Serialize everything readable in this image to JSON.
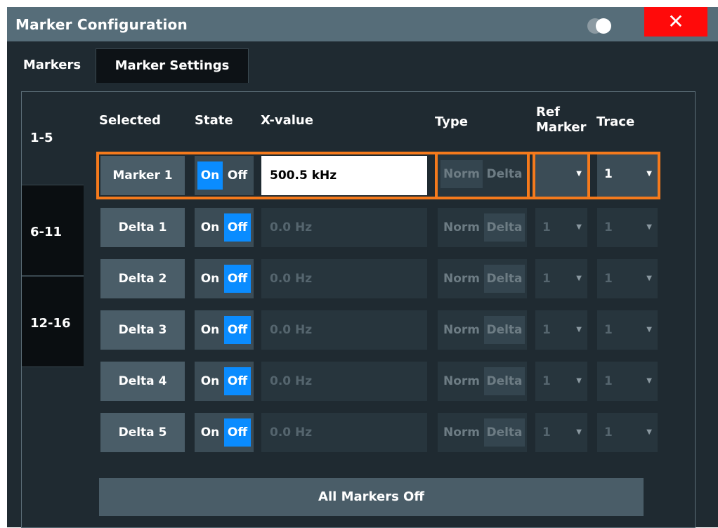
{
  "window": {
    "title": "Marker Configuration",
    "close_label": "✕"
  },
  "tabs": [
    "Markers",
    "Marker Settings"
  ],
  "side_tabs": [
    "1-5",
    "6-11",
    "12-16"
  ],
  "headers": {
    "selected": "Selected",
    "state": "State",
    "xvalue": "X-value",
    "type": "Type",
    "ref_marker": "Ref Marker",
    "trace": "Trace"
  },
  "rows": [
    {
      "name": "Marker 1",
      "on": "On",
      "off": "Off",
      "state": "On",
      "xvalue": "500.5 kHz",
      "norm": "Norm",
      "delta": "Delta",
      "ref": "",
      "trace": "1",
      "enabled": true
    },
    {
      "name": "Delta 1",
      "on": "On",
      "off": "Off",
      "state": "Off",
      "xvalue": "0.0 Hz",
      "norm": "Norm",
      "delta": "Delta",
      "ref": "1",
      "trace": "1",
      "enabled": false
    },
    {
      "name": "Delta 2",
      "on": "On",
      "off": "Off",
      "state": "Off",
      "xvalue": "0.0 Hz",
      "norm": "Norm",
      "delta": "Delta",
      "ref": "1",
      "trace": "1",
      "enabled": false
    },
    {
      "name": "Delta 3",
      "on": "On",
      "off": "Off",
      "state": "Off",
      "xvalue": "0.0 Hz",
      "norm": "Norm",
      "delta": "Delta",
      "ref": "1",
      "trace": "1",
      "enabled": false
    },
    {
      "name": "Delta 4",
      "on": "On",
      "off": "Off",
      "state": "Off",
      "xvalue": "0.0 Hz",
      "norm": "Norm",
      "delta": "Delta",
      "ref": "1",
      "trace": "1",
      "enabled": false
    },
    {
      "name": "Delta 5",
      "on": "On",
      "off": "Off",
      "state": "Off",
      "xvalue": "0.0 Hz",
      "norm": "Norm",
      "delta": "Delta",
      "ref": "1",
      "trace": "1",
      "enabled": false
    }
  ],
  "all_markers_off_label": "All Markers Off",
  "colors": {
    "accent": "#f57a1c",
    "toggle_on": "#0a8cff",
    "close": "#ff0a0a"
  }
}
